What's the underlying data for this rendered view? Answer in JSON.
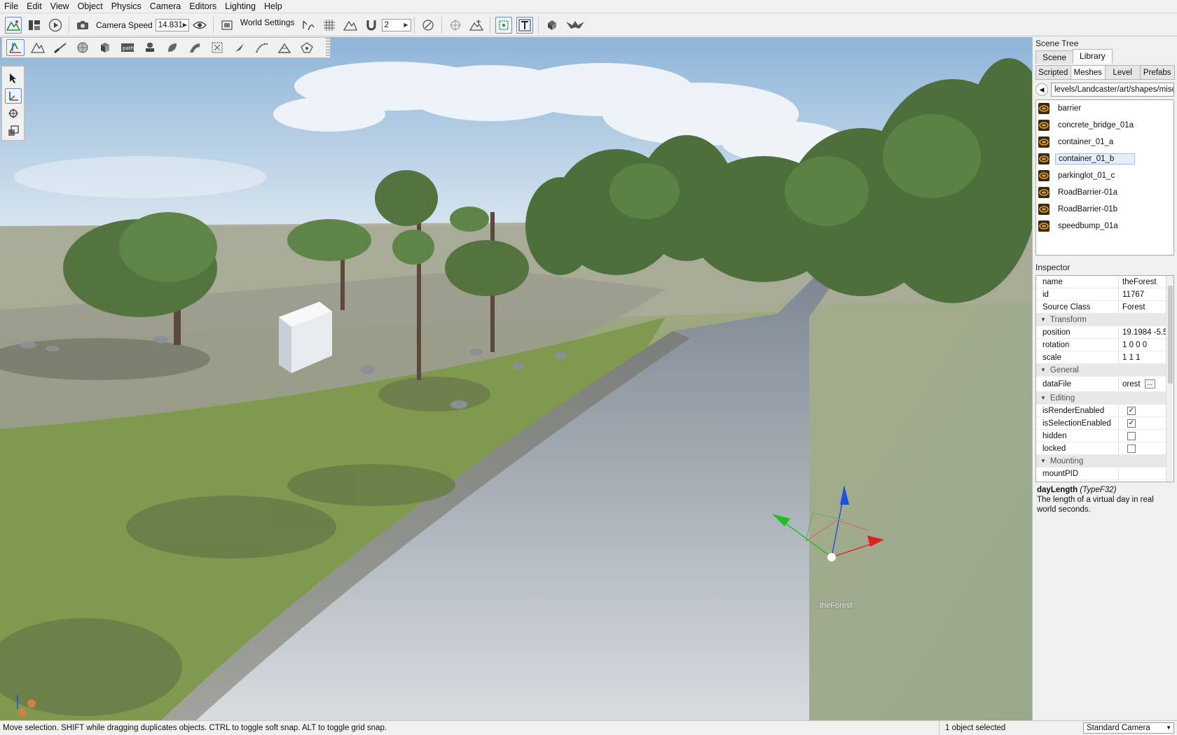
{
  "menu": [
    "File",
    "Edit",
    "View",
    "Object",
    "Physics",
    "Camera",
    "Editors",
    "Lighting",
    "Help"
  ],
  "toolbar": {
    "camera_speed_label": "Camera Speed",
    "camera_speed_value": "14.831",
    "world_settings_label": "World Settings",
    "grid_value": "2"
  },
  "scene_tree": {
    "title": "Scene Tree",
    "tabs": [
      "Scene",
      "Library"
    ],
    "active_tab": "Library",
    "sub_tabs": [
      "Scripted",
      "Meshes",
      "Level",
      "Prefabs"
    ],
    "active_sub_tab": "Meshes",
    "path": "levels/Landcaster/art/shapes/misc",
    "items": [
      "barrier",
      "concrete_bridge_01a",
      "container_01_a",
      "container_01_b",
      "parkinglot_01_c",
      "RoadBarrier-01a",
      "RoadBarrier-01b",
      "speedbump_01a"
    ],
    "selected_item": "container_01_b"
  },
  "inspector": {
    "title": "Inspector",
    "name_label": "name",
    "name_value": "theForest",
    "id_label": "id",
    "id_value": "11767",
    "class_label": "Source Class",
    "class_value": "Forest",
    "transform_group": "Transform",
    "position_label": "position",
    "position_value": "19.1984 -5.5",
    "rotation_label": "rotation",
    "rotation_value": "1 0 0 0",
    "scale_label": "scale",
    "scale_value": "1 1 1",
    "general_group": "General",
    "datafile_label": "dataFile",
    "datafile_value": "orest",
    "datafile_button": "...",
    "editing_group": "Editing",
    "render_label": "isRenderEnabled",
    "render_checked": true,
    "selection_label": "isSelectionEnabled",
    "selection_checked": true,
    "hidden_label": "hidden",
    "hidden_checked": false,
    "locked_label": "locked",
    "locked_checked": false,
    "mounting_group": "Mounting",
    "mountpid_label": "mountPID"
  },
  "help": {
    "field": "dayLength",
    "type": "(TypeF32)",
    "description": "The length of a virtual day in real world seconds."
  },
  "viewport": {
    "selected_object_label": "theForest"
  },
  "status": {
    "message": "Move selection.  SHIFT while dragging duplicates objects.  CTRL to toggle soft snap.  ALT to toggle grid snap.",
    "selection": "1 object selected",
    "camera_mode": "Standard Camera"
  },
  "colors": {
    "selection_bg": "#e4effb",
    "gizmo_x": "#e02020",
    "gizmo_y": "#20c020",
    "gizmo_z": "#2050e0"
  }
}
